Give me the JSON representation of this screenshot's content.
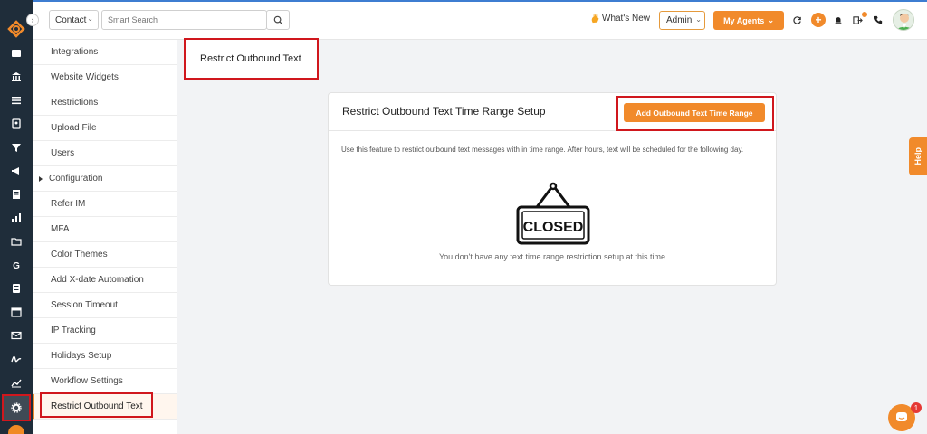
{
  "header": {
    "search_type": "Contact",
    "search_placeholder": "Smart Search",
    "whats_new": "What's New",
    "role": "Admin",
    "my_agents": "My Agents"
  },
  "sidebar": {
    "items": [
      {
        "label": "Integrations"
      },
      {
        "label": "Website Widgets"
      },
      {
        "label": "Restrictions"
      },
      {
        "label": "Upload File"
      },
      {
        "label": "Users"
      },
      {
        "label": "Configuration"
      },
      {
        "label": "Refer IM"
      },
      {
        "label": "MFA"
      },
      {
        "label": "Color Themes"
      },
      {
        "label": "Add X-date Automation"
      },
      {
        "label": "Session Timeout"
      },
      {
        "label": "IP Tracking"
      },
      {
        "label": "Holidays Setup"
      },
      {
        "label": "Workflow Settings"
      },
      {
        "label": "Restrict Outbound Text"
      }
    ]
  },
  "page": {
    "title": "Restrict Outbound Text"
  },
  "card": {
    "title": "Restrict Outbound Text Time Range Setup",
    "add_button": "Add Outbound Text Time Range",
    "description": "Use this feature to restrict outbound text messages with in time range. After hours, text will be scheduled for the following day.",
    "sign_text": "CLOSED",
    "empty_message": "You don't have any text time range restriction setup at this time"
  },
  "help_tab": "Help",
  "chat_badge": "1",
  "colors": {
    "accent": "#f18a2b",
    "rail": "#1f2d3a",
    "highlight_border": "#d0171d"
  }
}
